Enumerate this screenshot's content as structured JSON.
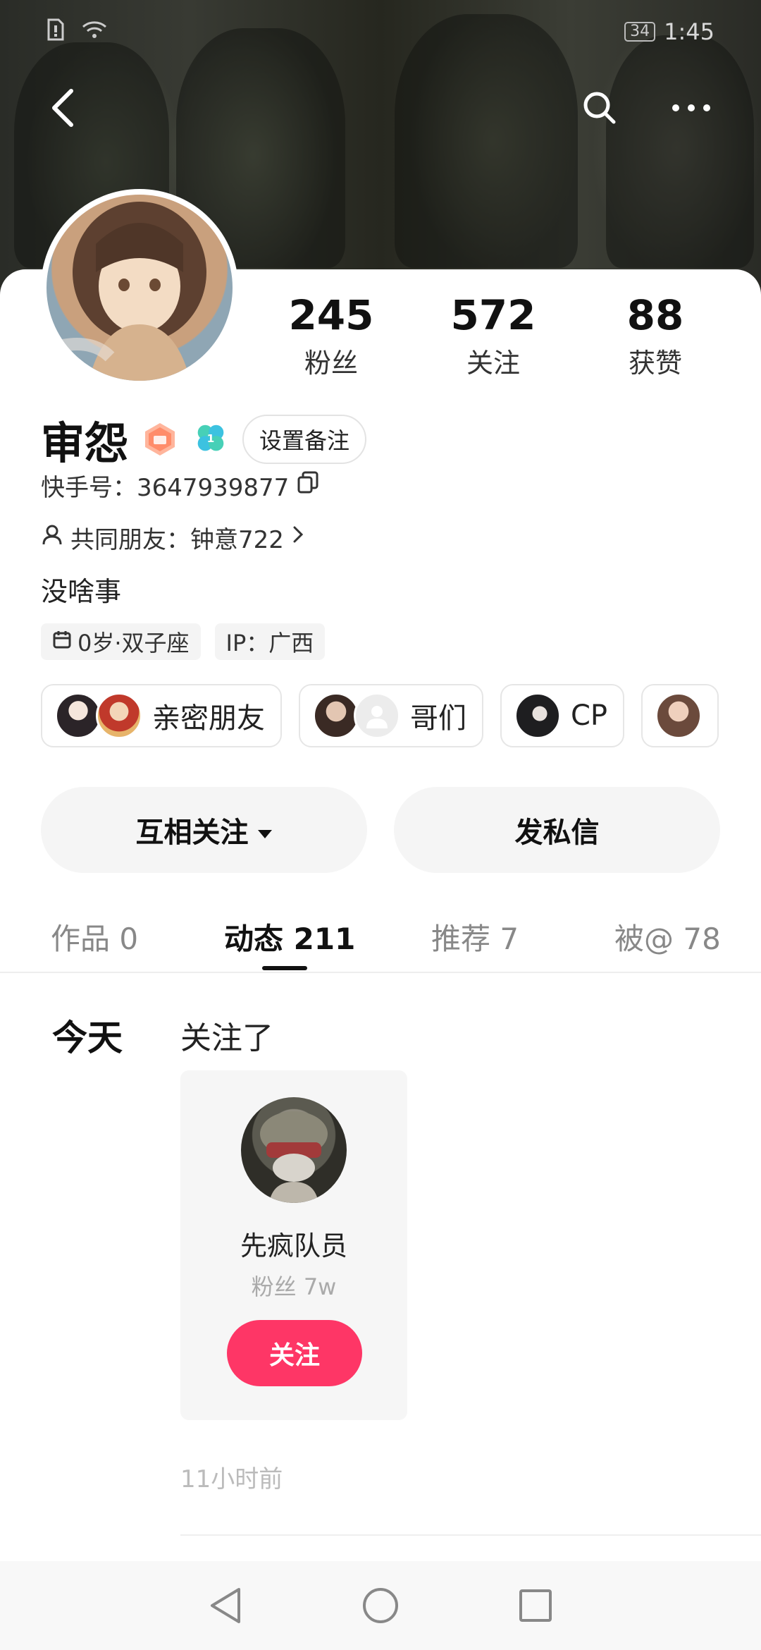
{
  "status_bar": {
    "time": "1:45",
    "battery": "34"
  },
  "profile": {
    "stats": [
      {
        "num": "245",
        "label": "粉丝"
      },
      {
        "num": "572",
        "label": "关注"
      },
      {
        "num": "88",
        "label": "获赞"
      }
    ],
    "name": "审怨",
    "remark_button": "设置备注",
    "id_label": "快手号：3647939877",
    "mutual_friends": "共同朋友：钟意722",
    "bio": "没啥事",
    "tags": [
      "0岁·双子座",
      "IP：广西"
    ],
    "badge_level": "1",
    "groups": [
      {
        "label": "亲密朋友"
      },
      {
        "label": "哥们"
      },
      {
        "label": "CP"
      }
    ]
  },
  "actions": {
    "follow_mutual": "互相关注",
    "message": "发私信"
  },
  "tabs": [
    "作品 0",
    "动态 211",
    "推荐 7",
    "被@ 78"
  ],
  "feed": {
    "day": "今天",
    "action": "关注了",
    "card": {
      "name": "先疯队员",
      "fans": "粉丝 7w",
      "follow": "关注"
    },
    "time": "11小时前"
  },
  "colors": {
    "accent": "#fe3666"
  }
}
